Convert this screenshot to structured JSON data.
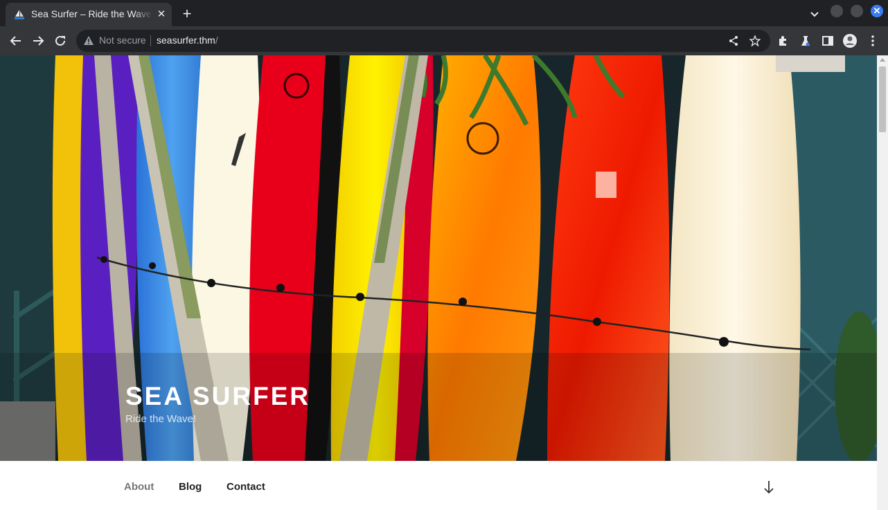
{
  "browser": {
    "tab": {
      "title": "Sea Surfer – Ride the Wave",
      "close_label": "✕"
    },
    "new_tab_label": "+",
    "address_bar": {
      "security_label": "Not secure",
      "url_host": "seasurfer.thm",
      "url_path": "/"
    },
    "window_close_label": "✕"
  },
  "site": {
    "title": "Sea Surfer",
    "description": "Ride the Wave!",
    "menu": [
      {
        "label": "About",
        "current": true
      },
      {
        "label": "Blog",
        "current": false
      },
      {
        "label": "Contact",
        "current": false
      }
    ]
  },
  "colors": {
    "chrome_bg": "#202124",
    "toolbar_bg": "#35363a",
    "accent_blue": "#3c7cf2"
  },
  "icons": [
    "back-arrow-icon",
    "forward-arrow-icon",
    "reload-icon",
    "warning-icon",
    "share-icon",
    "bookmark-star-icon",
    "extensions-icon",
    "labs-flask-icon",
    "side-panel-icon",
    "profile-avatar-icon",
    "more-menu-icon",
    "chevron-down-icon",
    "arrow-down-icon"
  ]
}
